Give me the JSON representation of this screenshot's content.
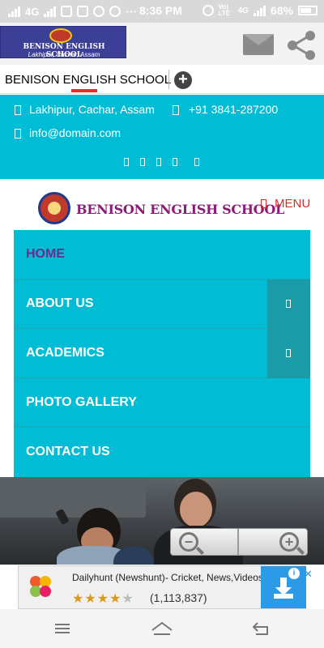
{
  "status_bar": {
    "network": "4G",
    "time": "8:36 PM",
    "volte": "Vo) LTE",
    "network2": "4G",
    "battery": "68%"
  },
  "app_bar": {
    "logo_title": "BENISON ENGLISH SCHOOL",
    "logo_subtitle": "Lakhipur, Cachar, Assam",
    "icons": [
      "mail-icon",
      "share-icon"
    ]
  },
  "tabs": {
    "active_label": "BENISON ENGLISH SCHOOL",
    "add_label": "+"
  },
  "contact": {
    "address": "Lakhipur, Cachar, Assam",
    "phone": "+91 3841-287200",
    "email": "info@domain.com",
    "social_icons": [
      "facebook-icon",
      "twitter-icon",
      "google-plus-icon",
      "linkedin-icon",
      "pinterest-icon"
    ]
  },
  "header": {
    "site_name": "BENISON ENGLISH SCHOOL",
    "menu_label": "MENU"
  },
  "nav": {
    "items": [
      {
        "label": "HOME",
        "active": true,
        "has_submenu": false
      },
      {
        "label": "ABOUT US",
        "active": false,
        "has_submenu": true
      },
      {
        "label": "ACADEMICS",
        "active": false,
        "has_submenu": true
      },
      {
        "label": "PHOTO GALLERY",
        "active": false,
        "has_submenu": false
      },
      {
        "label": "CONTACT US",
        "active": false,
        "has_submenu": false
      }
    ]
  },
  "zoom": {
    "out_icon": "zoom-out-icon",
    "in_icon": "zoom-in-icon"
  },
  "ad": {
    "title": "Dailyhunt (Newshunt)- Cricket, News,Videos",
    "stars": "★★★★",
    "half_star": "★",
    "rating_count": "(1,113,837)",
    "info": "i",
    "close": "✕"
  },
  "colors": {
    "accent": "#00bcd4",
    "submenu": "#1b9aa8",
    "active_nav": "#6a2c91",
    "menu_red": "#d72b2b",
    "brand_purple": "#8b1c7a"
  }
}
